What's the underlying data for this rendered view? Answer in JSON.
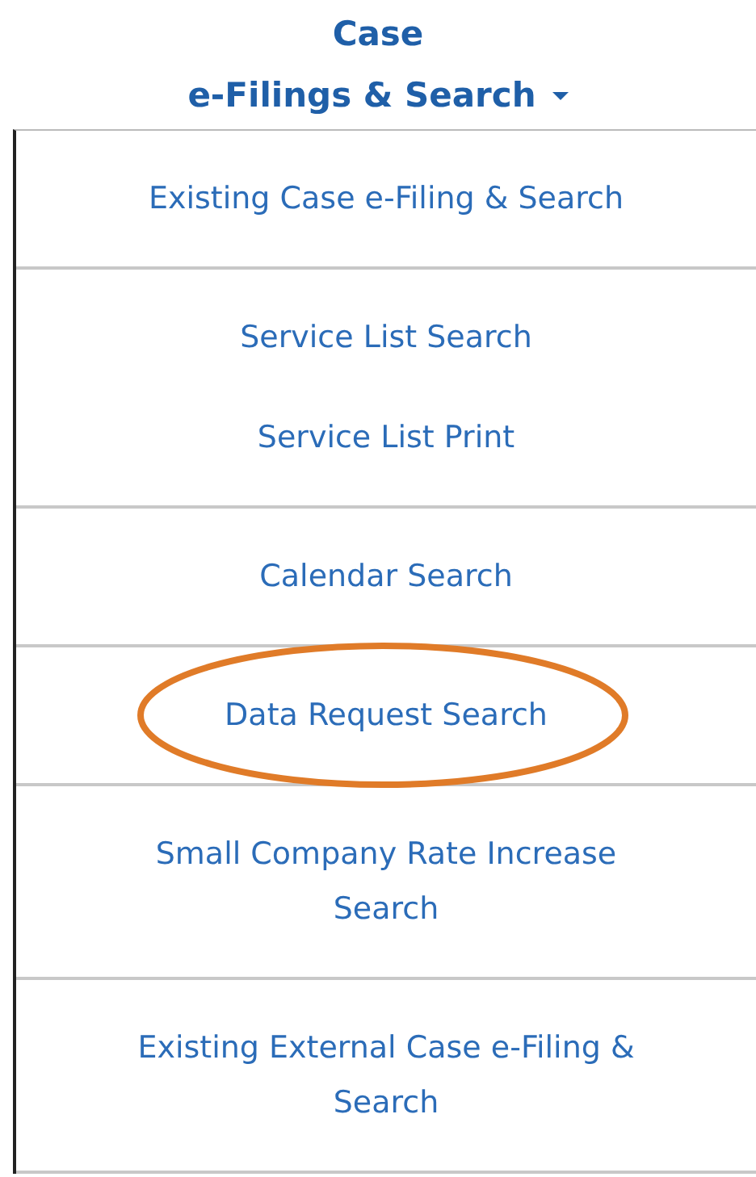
{
  "menu": {
    "title_lines": [
      "Case",
      "e-Filings & Search"
    ],
    "expanded": true,
    "groups": [
      {
        "items": [
          {
            "label": "Existing Case e-Filing & Search",
            "circled": false
          }
        ]
      },
      {
        "items": [
          {
            "label": "Service List Search",
            "circled": false
          },
          {
            "label": "Service List Print",
            "circled": false
          }
        ]
      },
      {
        "items": [
          {
            "label": "Calendar Search",
            "circled": false
          }
        ]
      },
      {
        "items": [
          {
            "label": "Data Request Search",
            "circled": true
          }
        ]
      },
      {
        "items": [
          {
            "label": "Small Company Rate Increase Search",
            "circled": false
          }
        ]
      },
      {
        "items": [
          {
            "label": "Existing External Case e-Filing & Search",
            "circled": false
          }
        ]
      }
    ]
  }
}
